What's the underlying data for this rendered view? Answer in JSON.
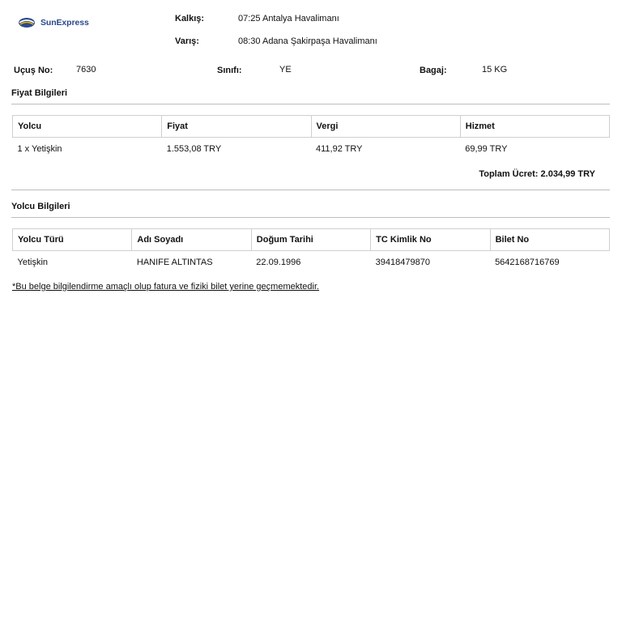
{
  "brand": {
    "name": "SunExpress",
    "color": "#2a4a8c"
  },
  "flight": {
    "departure_label": "Kalkış:",
    "departure_value": "07:25 Antalya Havalimanı",
    "arrival_label": "Varış:",
    "arrival_value": "08:30 Adana Şakirpaşa Havalimanı",
    "flight_no_label": "Uçuş No:",
    "flight_no_value": "7630",
    "class_label": "Sınıfı:",
    "class_value": "YE",
    "baggage_label": "Bagaj:",
    "baggage_value": "15 KG"
  },
  "price": {
    "title": "Fiyat Bilgileri",
    "headers": [
      "Yolcu",
      "Fiyat",
      "Vergi",
      "Hizmet"
    ],
    "rows": [
      [
        "1 x Yetişkin",
        "1.553,08 TRY",
        "411,92 TRY",
        "69,99 TRY"
      ]
    ],
    "total": "Toplam Ücret: 2.034,99 TRY"
  },
  "passenger": {
    "title": "Yolcu Bilgileri",
    "headers": [
      "Yolcu Türü",
      "Adı Soyadı",
      "Doğum Tarihi",
      "TC Kimlik No",
      "Bilet No"
    ],
    "rows": [
      [
        "Yetişkin",
        "HANIFE ALTINTAS",
        "22.09.1996",
        "39418479870",
        "5642168716769"
      ]
    ]
  },
  "note": "*Bu belge bilgilendirme amaçlı olup fatura ve fiziki bilet yerine geçmemektedir."
}
